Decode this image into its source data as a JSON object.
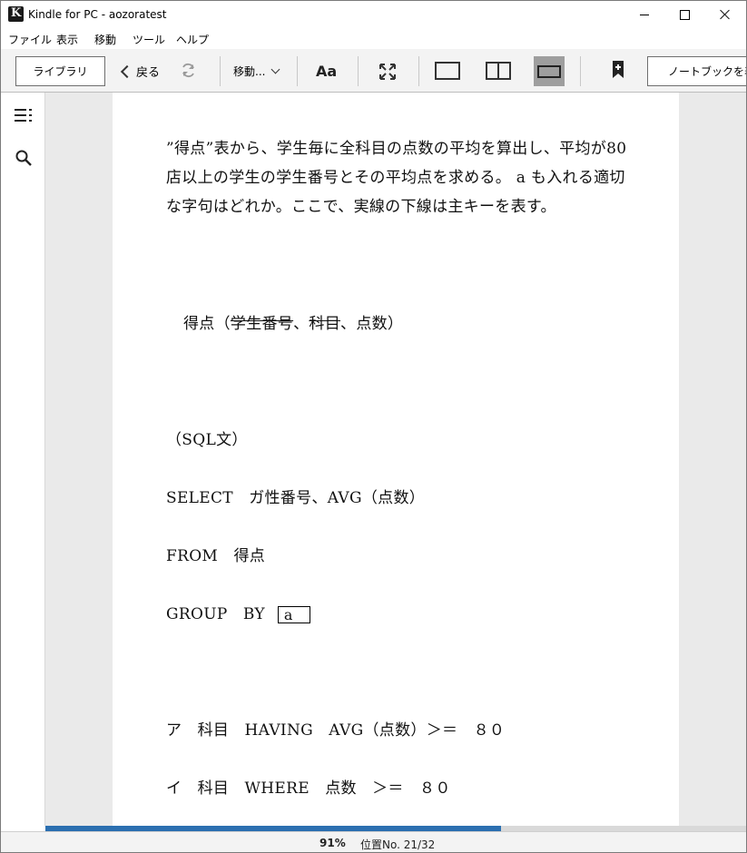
{
  "window": {
    "title": "Kindle for PC - aozoratest"
  },
  "menu": [
    "ファイル",
    "表示",
    "移動",
    "ツール",
    "ヘルプ"
  ],
  "toolbar": {
    "library": "ライブラリ",
    "back": "戻る",
    "goto": "移動...",
    "font": "Aa",
    "notebook": "ノートブックを表示"
  },
  "content": {
    "intro": "”得点”表から、学生毎に全科目の点数の平均を算出し、平均が80店以上の学生の学生番号とその平均点を求める。 a も入れる適切な字句はどれか。ここで、実線の下線は主キーを表す。",
    "schema_prefix": "得点（",
    "schema_key1": "学生番号",
    "schema_sep1": "、",
    "schema_key2": "科目",
    "schema_rest": "、点数）",
    "sql_heading": "（SQL文）",
    "sql_select": "SELECT　ガ性番号、AVG（点数）",
    "sql_from": "FROM　得点",
    "sql_group": "GROUP　BY",
    "blank": "a",
    "option_a": "ア　科目　HAVING　AVG（点数）＞＝　８０",
    "option_i": "イ　科目　WHERE　点数　＞＝　８０"
  },
  "status": {
    "progress": 0.65,
    "percent": "91%",
    "location": "位置No. 21/32"
  }
}
